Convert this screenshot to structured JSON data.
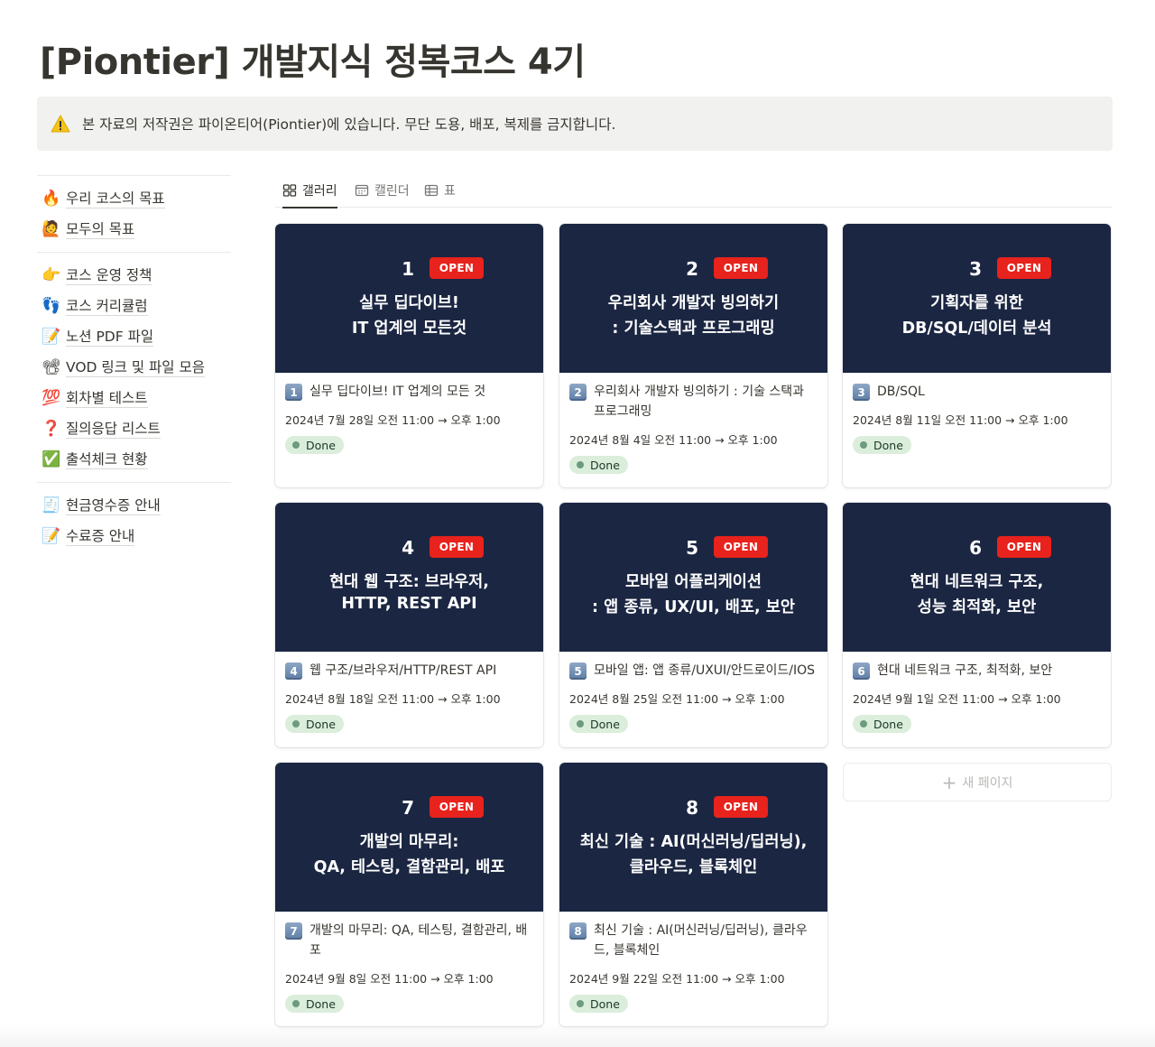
{
  "page": {
    "title": "[Piontier] 개발지식 정복코스 4기"
  },
  "callout": {
    "icon": "warning-icon",
    "text": "본 자료의 저작권은 파이온티어(Piontier)에 있습니다. 무단 도용, 배포, 복제를 금지합니다."
  },
  "sidebar": {
    "group1": [
      {
        "icon": "🔥",
        "label": "우리 코스의 목표"
      },
      {
        "icon": "🙋",
        "label": "모두의 목표"
      }
    ],
    "group2": [
      {
        "icon": "👉",
        "label": "코스 운영 정책"
      },
      {
        "icon": "👣",
        "label": "코스 커리큘럼"
      },
      {
        "icon": "📝",
        "label": "노션 PDF 파일"
      },
      {
        "icon": "📽",
        "label": "VOD 링크 및 파일 모음"
      },
      {
        "icon": "💯",
        "label": "회차별 테스트"
      },
      {
        "icon": "❓",
        "label": "질의응답 리스트"
      },
      {
        "icon": "✅",
        "label": "출석체크 현황"
      }
    ],
    "group3": [
      {
        "icon": "🧾",
        "label": "현금영수증 안내"
      },
      {
        "icon": "📝",
        "label": "수료증 안내"
      }
    ]
  },
  "tabs": [
    {
      "label": "갤러리",
      "icon": "gallery-icon",
      "active": true
    },
    {
      "label": "캘린더",
      "icon": "calendar-icon",
      "active": false
    },
    {
      "label": "표",
      "icon": "table-icon",
      "active": false
    }
  ],
  "cards": [
    {
      "num": "1",
      "badge": "OPEN",
      "cover_line1": "실무 딥다이브!",
      "cover_line2": "IT 업계의 모든것",
      "keycap": "1",
      "title": "실무 딥다이브! IT 업계의 모든 것",
      "date": "2024년 7월 28일 오전 11:00 → 오후 1:00",
      "status": "Done"
    },
    {
      "num": "2",
      "badge": "OPEN",
      "cover_line1": "우리회사 개발자 빙의하기",
      "cover_line2": ": 기술스택과 프로그래밍",
      "keycap": "2",
      "title": "우리회사 개발자 빙의하기 : 기술 스택과 프로그래밍",
      "date": "2024년 8월 4일 오전 11:00 → 오후 1:00",
      "status": "Done"
    },
    {
      "num": "3",
      "badge": "OPEN",
      "cover_line1": "기획자를 위한",
      "cover_line2": "DB/SQL/데이터 분석",
      "keycap": "3",
      "title": "DB/SQL",
      "date": "2024년 8월 11일 오전 11:00 → 오후 1:00",
      "status": "Done"
    },
    {
      "num": "4",
      "badge": "OPEN",
      "cover_line1": "현대 웹 구조: 브라우저,",
      "cover_line2": "HTTP, REST API",
      "keycap": "4",
      "title": "웹 구조/브라우저/HTTP/REST API",
      "date": "2024년 8월 18일 오전 11:00 → 오후 1:00",
      "status": "Done"
    },
    {
      "num": "5",
      "badge": "OPEN",
      "cover_line1": "모바일 어플리케이션",
      "cover_line2": ": 앱 종류, UX/UI, 배포, 보안",
      "keycap": "5",
      "title": "모바일 앱: 앱 종류/UXUI/안드로이드/IOS",
      "date": "2024년 8월 25일 오전 11:00 → 오후 1:00",
      "status": "Done"
    },
    {
      "num": "6",
      "badge": "OPEN",
      "cover_line1": "현대 네트워크 구조,",
      "cover_line2": "성능 최적화, 보안",
      "keycap": "6",
      "title": "현대 네트워크 구조, 최적화, 보안",
      "date": "2024년 9월 1일 오전 11:00 → 오후 1:00",
      "status": "Done"
    },
    {
      "num": "7",
      "badge": "OPEN",
      "cover_line1": "개발의 마무리:",
      "cover_line2": "QA, 테스팅, 결함관리, 배포",
      "keycap": "7",
      "title": "개발의 마무리: QA, 테스팅, 결함관리, 배포",
      "date": "2024년 9월 8일 오전 11:00 → 오후 1:00",
      "status": "Done"
    },
    {
      "num": "8",
      "badge": "OPEN",
      "cover_line1": "최신 기술 : AI(머신러닝/딥러닝),",
      "cover_line2": "클라우드, 블록체인",
      "keycap": "8",
      "title": "최신 기술 : AI(머신러닝/딥러닝), 클라우드, 블록체인",
      "date": "2024년 9월 22일 오전 11:00 → 오후 1:00",
      "status": "Done"
    }
  ],
  "new_page": {
    "plus": "+",
    "label": "새 페이지"
  },
  "colors": {
    "cover_bg": "#1b2642",
    "badge_red": "#e8221c",
    "status_bg": "#dbeddb",
    "status_dot": "#6c9b7d",
    "callout_bg": "#f1f1ef"
  }
}
